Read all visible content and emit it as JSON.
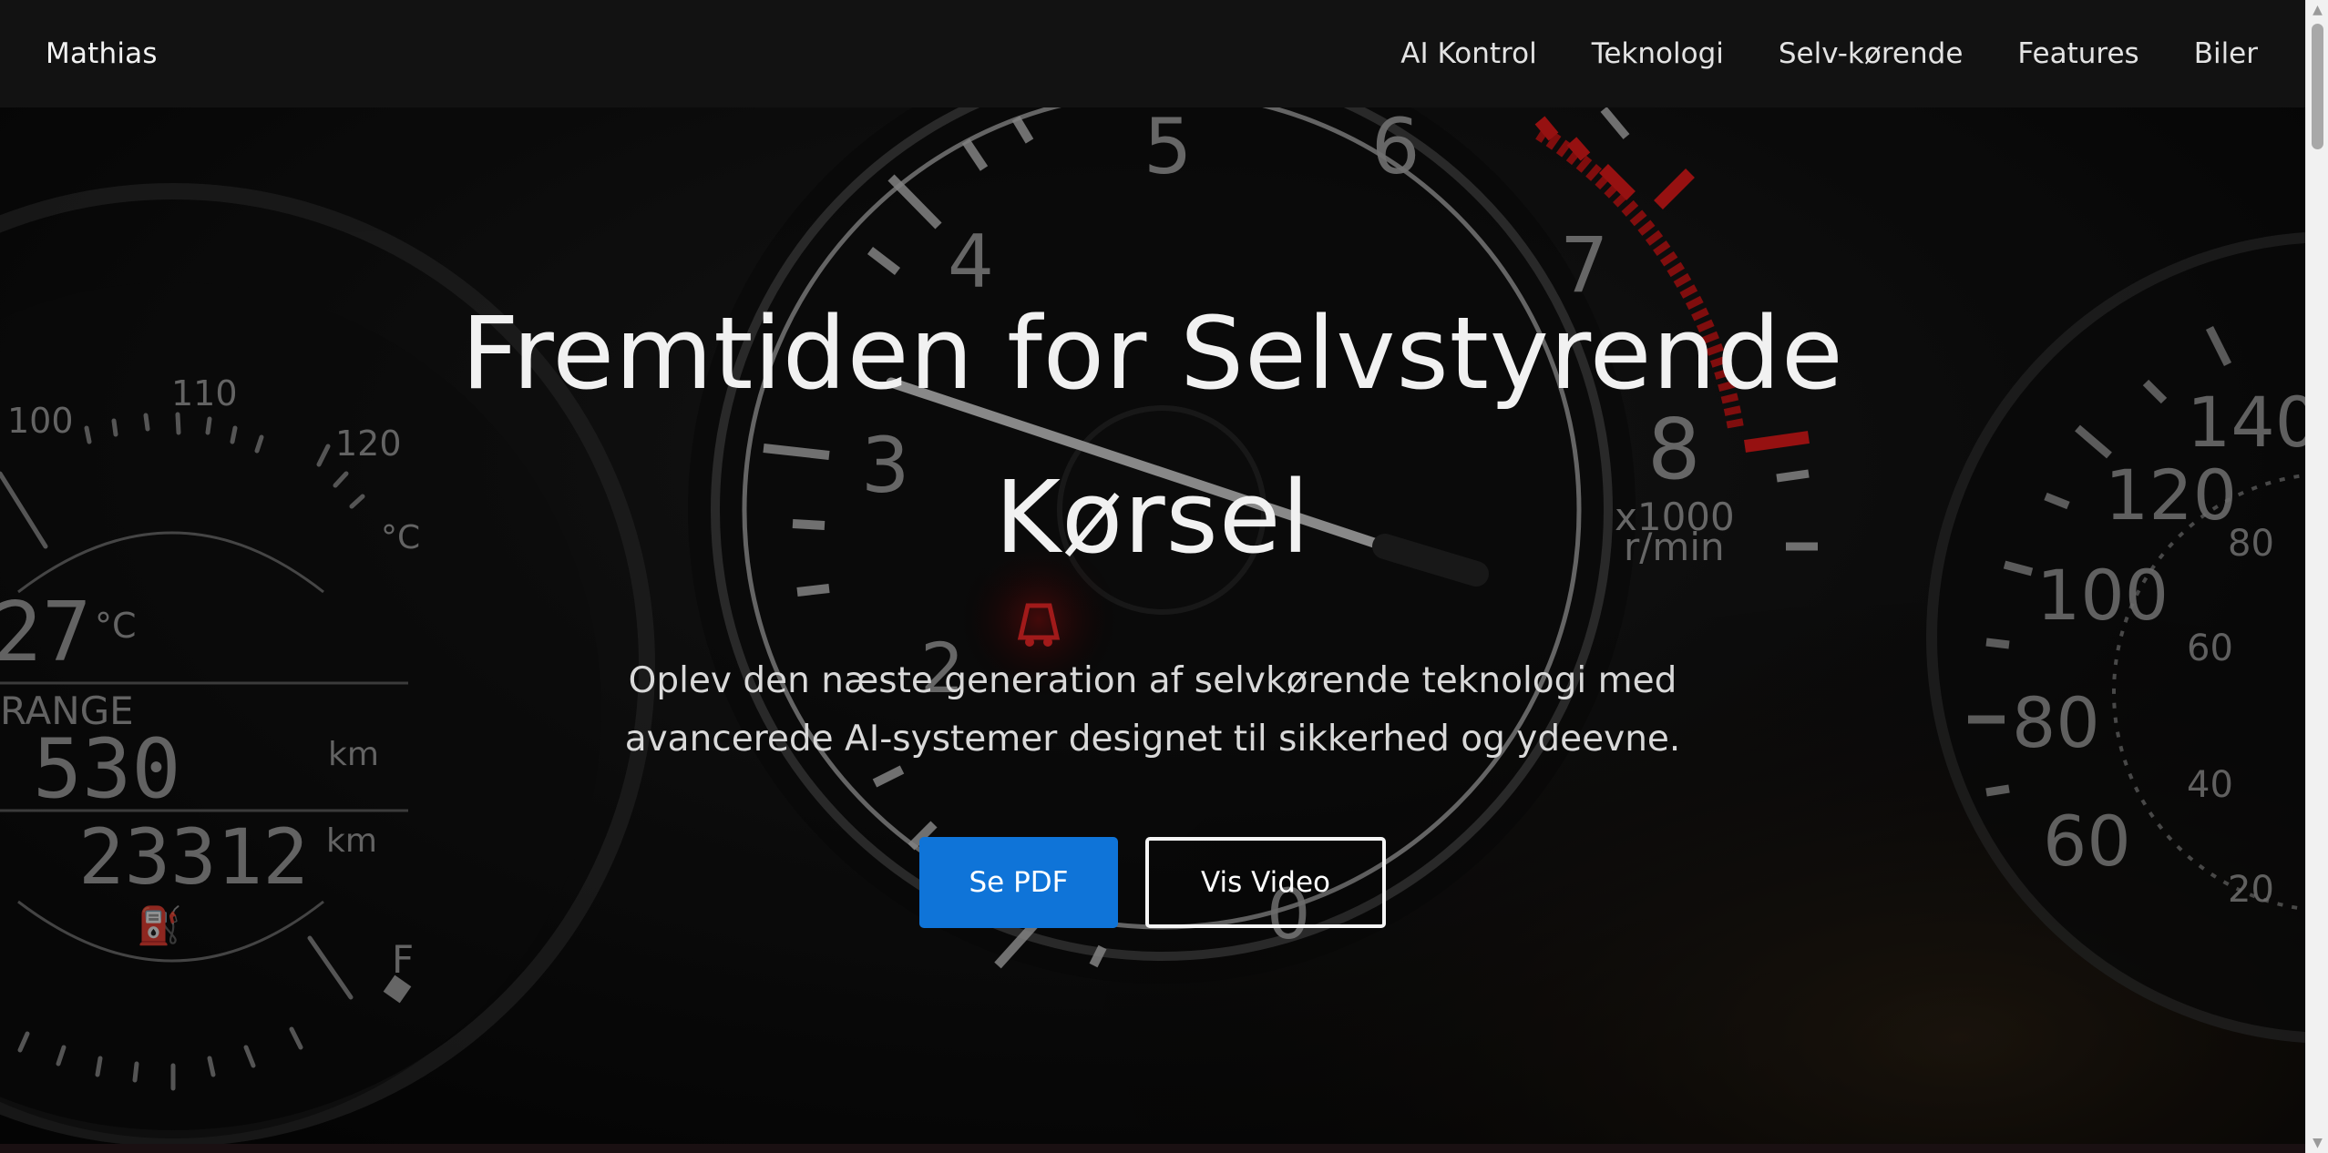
{
  "navbar": {
    "brand": "Mathias",
    "links": [
      "AI Kontrol",
      "Teknologi",
      "Selv-kørende",
      "Features",
      "Biler"
    ]
  },
  "hero": {
    "title": "Fremtiden for Selvstyrende Kørsel",
    "subtitle": "Oplev den næste generation af selvkørende teknologi med avancerede AI-systemer designet til sikkerhed og ydeevne.",
    "primary_button": "Se PDF",
    "secondary_button": "Vis Video"
  },
  "dashboard": {
    "tach_numbers": [
      "0",
      "2",
      "3",
      "4",
      "5",
      "6",
      "7",
      "8"
    ],
    "tach_unit": "x1000",
    "tach_unit2": "r/min",
    "left_scale": [
      "100",
      "110",
      "120"
    ],
    "left_temp_unit": "°C",
    "left_temp": "27",
    "left_temp_small_unit": "°C",
    "range_label": "RANGE",
    "range_value": "530",
    "range_unit": "km",
    "odometer": "23312",
    "odo_unit": "km",
    "fuel_full": "F",
    "speed_numbers": [
      "140",
      "120",
      "100",
      "80",
      "60"
    ],
    "speed_inner": [
      "80",
      "60",
      "40",
      "20"
    ]
  },
  "colors": {
    "navbar_bg": "#121212",
    "primary": "#0f74d8",
    "redline": "#d01818"
  },
  "scrollbar": {
    "up_icon": "▲",
    "down_icon": "▼"
  }
}
